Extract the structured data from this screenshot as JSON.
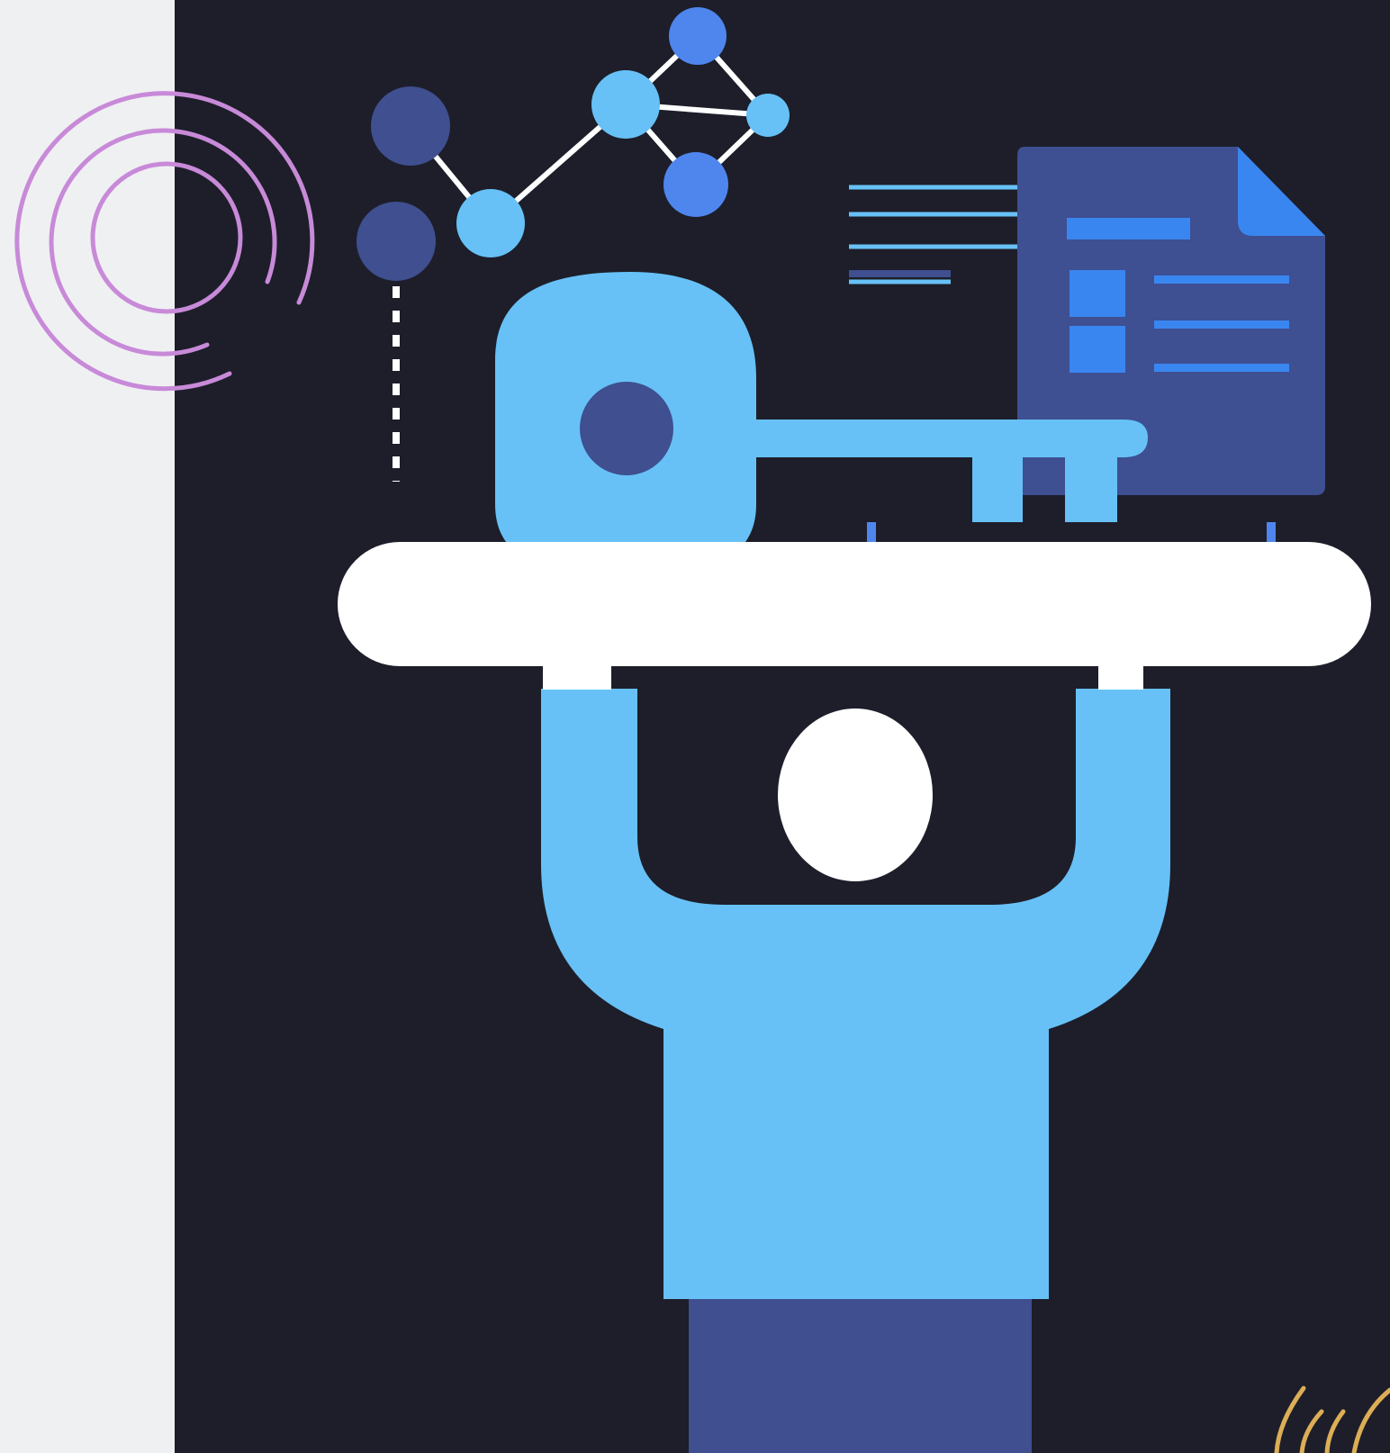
{
  "illustration": {
    "subject": "person-holding-key-and-document",
    "colors": {
      "page_background": "#eff0f2",
      "panel_background": "#1d1e2a",
      "light_blue": "#67c1f6",
      "mid_blue": "#4f86ee",
      "bright_blue": "#3a86f0",
      "navy": "#3f4f8f",
      "document_navy": "#3e4f92",
      "white": "#ffffff",
      "ring_purple": "#c88ad8",
      "accent_gold": "#dcae55"
    }
  }
}
